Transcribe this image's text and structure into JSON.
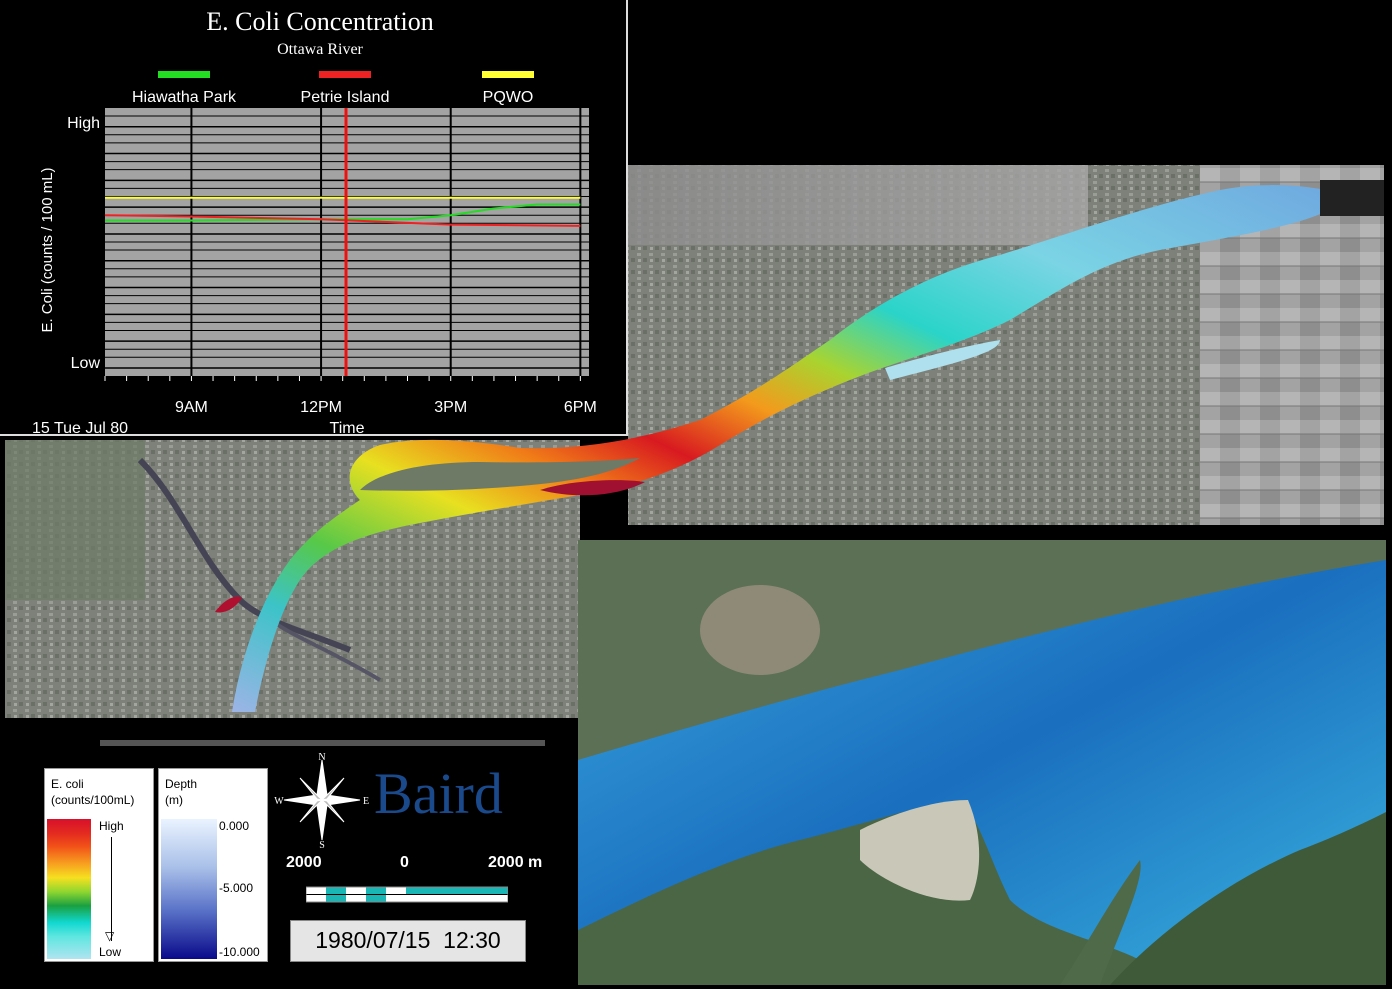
{
  "chart_data": {
    "type": "line",
    "title": "E. Coli Concentration",
    "subtitle": "Ottawa River",
    "xlabel": "Time",
    "ylabel": "E. Coli (counts / 100 mL)",
    "x_ticks": [
      "9AM",
      "12PM",
      "3PM",
      "6PM"
    ],
    "y_ticks": [
      "High",
      "Low"
    ],
    "date_label": "15 Tue Jul 80",
    "current_time_marker": "12:30",
    "grid": true,
    "legend_position": "top",
    "series": [
      {
        "name": "Hiawatha Park",
        "color": "#22dd22",
        "x": [
          "7:00",
          "9:00",
          "12:00",
          "14:00",
          "15:00",
          "16:00",
          "17:00",
          "18:00"
        ],
        "y_fraction": [
          0.58,
          0.58,
          0.585,
          0.585,
          0.6,
          0.625,
          0.64,
          0.64
        ]
      },
      {
        "name": "Petrie Island",
        "color": "#ee2222",
        "x": [
          "7:00",
          "9:00",
          "12:00",
          "15:00",
          "18:00"
        ],
        "y_fraction": [
          0.6,
          0.595,
          0.585,
          0.565,
          0.56
        ]
      },
      {
        "name": "PQWO",
        "color": "#ffff33",
        "x": [
          "7:00",
          "18:00"
        ],
        "y_fraction": [
          0.665,
          0.665
        ]
      }
    ]
  },
  "legend": {
    "ecoli_title": "E. coli",
    "ecoli_units": "(counts/100mL)",
    "ecoli_high": "High",
    "ecoli_low": "Low",
    "depth_title": "Depth",
    "depth_units": "(m)",
    "depth_ticks": [
      "0.000",
      "-5.000",
      "-10.000"
    ]
  },
  "compass": {
    "n": "N",
    "s": "S",
    "e": "E",
    "w": "W"
  },
  "brand": "Baird",
  "scale_bar": {
    "left": "2000",
    "center": "0",
    "right": "2000 m"
  },
  "timestamp": "1980/07/15  12:30",
  "colors": {
    "ecoli_gradient": [
      "#d8102a",
      "#f25418",
      "#f8a020",
      "#f5e020",
      "#8fd630",
      "#1aa040",
      "#11d8d0",
      "#5fe6e0"
    ],
    "depth_gradient": [
      "#eaf3ff",
      "#7a99d6",
      "#0a0a8a"
    ],
    "river_blue": "#2b8fd0",
    "scale_cyan": "#1ab5b5"
  }
}
